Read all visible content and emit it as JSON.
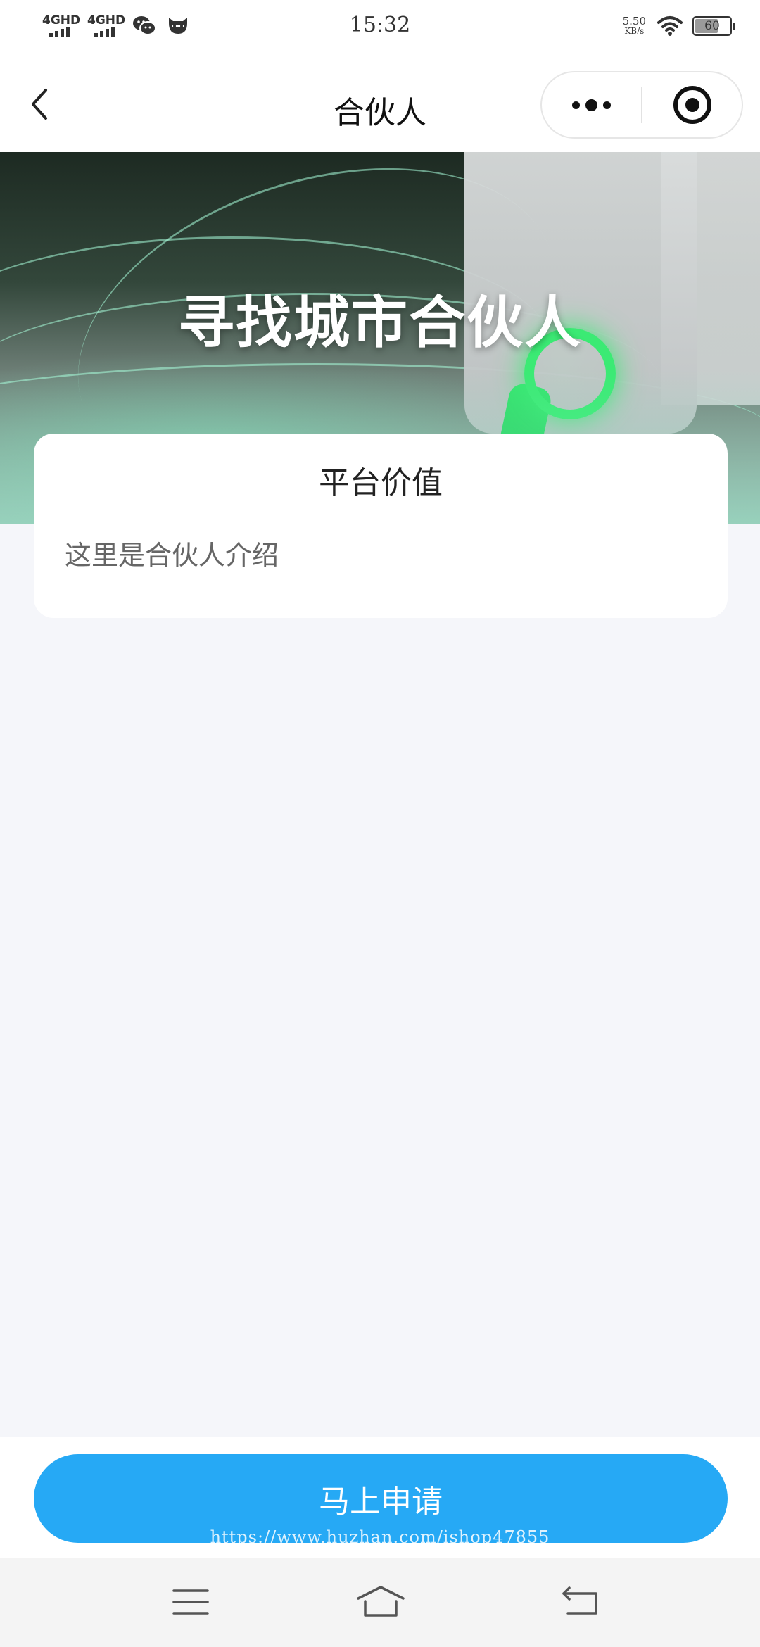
{
  "status_bar": {
    "network1": "4GHD",
    "network2": "4GHD",
    "time": "15:32",
    "speed_value": "5.50",
    "speed_unit": "KB/s",
    "battery": "60",
    "icons": [
      "signal-icon",
      "signal-icon",
      "wechat-icon",
      "app-mascot-icon",
      "wifi-icon",
      "battery-icon"
    ]
  },
  "nav": {
    "title": "合伙人",
    "back_icon": "chevron-left-icon",
    "more_icon": "more-dots-icon",
    "close_icon": "target-icon"
  },
  "banner": {
    "headline": "寻找城市合伙人"
  },
  "card": {
    "title": "平台价值",
    "body": "这里是合伙人介绍"
  },
  "footer": {
    "apply_label": "马上申请"
  },
  "watermark": "https://www.huzhan.com/ishop47855",
  "colors": {
    "accent": "#26a9f5",
    "page_bg": "#f5f6fa",
    "card_bg": "#ffffff",
    "banner_glow": "#3bea74"
  }
}
